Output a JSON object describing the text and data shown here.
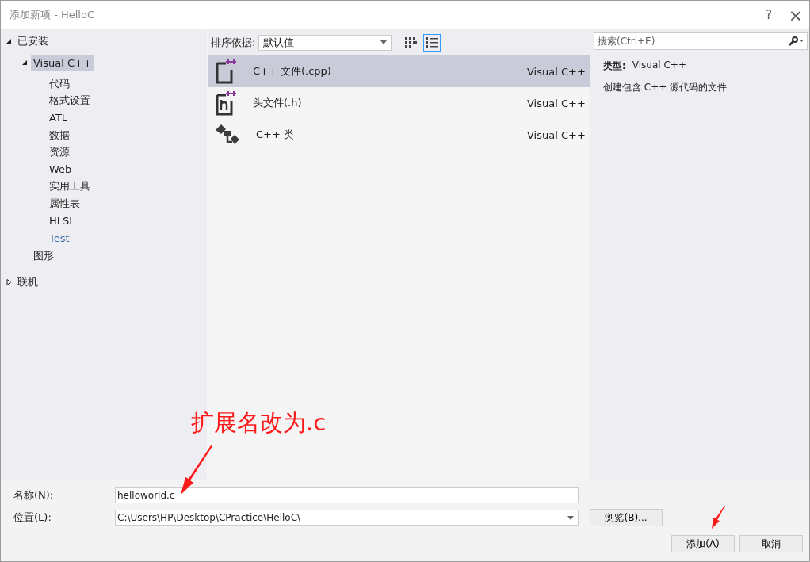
{
  "window": {
    "title": "添加新项 - HelloC",
    "help": "?",
    "close": "×"
  },
  "tree": [
    {
      "label": "已安装",
      "expanded": true,
      "selected": false,
      "children": [
        {
          "label": "Visual C++",
          "expanded": true,
          "selected": true,
          "children": [
            {
              "label": "代码",
              "selected": false
            },
            {
              "label": "格式设置",
              "selected": false
            },
            {
              "label": "ATL",
              "selected": false
            },
            {
              "label": "数据",
              "selected": false
            },
            {
              "label": "资源",
              "selected": false
            },
            {
              "label": "Web",
              "selected": false
            },
            {
              "label": "实用工具",
              "selected": false
            },
            {
              "label": "属性表",
              "selected": false
            },
            {
              "label": "HLSL",
              "selected": false
            },
            {
              "label": "Test",
              "selected": false
            }
          ]
        },
        {
          "label": "图形",
          "selected": false
        }
      ]
    },
    {
      "label": "联机",
      "expanded": false,
      "selected": false
    }
  ],
  "sort": {
    "label": "排序依据:",
    "value": "默认值"
  },
  "view_toggle": [
    {
      "kind": "grid",
      "selected": false
    },
    {
      "kind": "list",
      "selected": true
    }
  ],
  "items": [
    {
      "kind": "cpp",
      "name": "C++ 文件(.cpp)",
      "category": "Visual C++",
      "selected": true
    },
    {
      "kind": "header",
      "name": "头文件(.h)",
      "category": "Visual C++",
      "selected": false
    },
    {
      "kind": "class",
      "name": "C++ 类",
      "category": "Visual C++",
      "selected": false
    }
  ],
  "search": {
    "placeholder": "搜索(Ctrl+E)"
  },
  "details": {
    "type_label": "类型:",
    "type_value": "Visual C++",
    "description": "创建包含 C++ 源代码的文件"
  },
  "form": [
    {
      "label": "名称(N):",
      "value": "helloworld.c",
      "kind": "text"
    },
    {
      "label": "位置(L):",
      "value": "C:\\Users\\HP\\Desktop\\CPractice\\HelloC\\",
      "kind": "combo"
    }
  ],
  "buttons": {
    "browse": "浏览(B)...",
    "add": "添加(A)",
    "cancel": "取消"
  },
  "annotation": {
    "text": "扩展名改为.c"
  }
}
